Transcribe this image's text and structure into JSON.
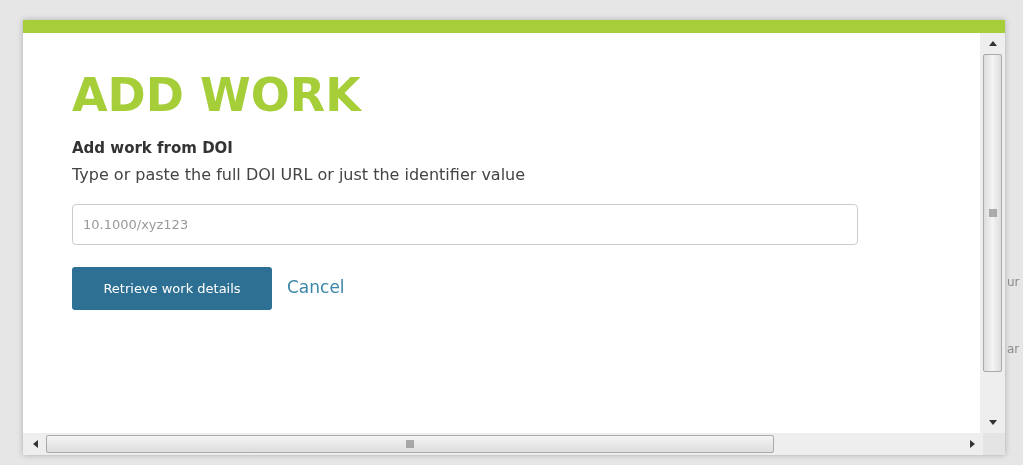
{
  "dialog": {
    "title": "ADD WORK",
    "section_heading": "Add work from DOI",
    "description": "Type or paste the full DOI URL or just the identifier value",
    "doi_field": {
      "placeholder": "10.1000/xyz123"
    },
    "buttons": [
      {
        "kind": "primary",
        "label": "Retrieve work details"
      },
      {
        "kind": "link",
        "label": "Cancel"
      }
    ]
  },
  "background": {
    "fragments": [
      "ur",
      "ar"
    ]
  }
}
